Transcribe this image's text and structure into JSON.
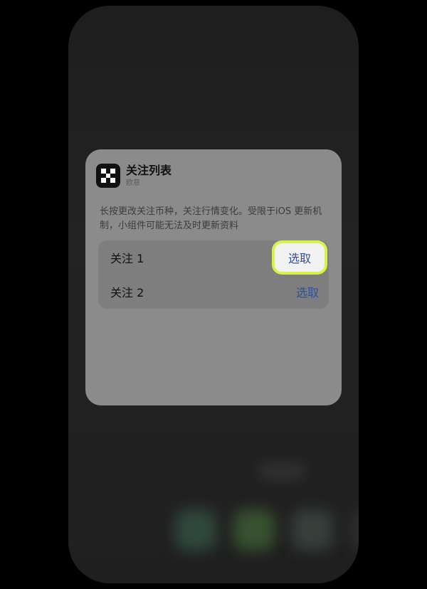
{
  "widget": {
    "title": "关注列表",
    "subtitle": "欧意",
    "description": "长按更改关注币种，关注行情变化。受限于iOS 更新机制，小组件可能无法及时更新资料",
    "rows": [
      {
        "label": "关注 1",
        "action": "选取",
        "highlighted": true
      },
      {
        "label": "关注 2",
        "action": "选取",
        "highlighted": false
      }
    ]
  },
  "icons": {
    "app_icon": "grid-logo-icon"
  },
  "colors": {
    "card": "#8b8b8b",
    "list": "#7e7e7e",
    "accent": "#2f4fa0",
    "highlight_ring": "#d9f24a"
  }
}
